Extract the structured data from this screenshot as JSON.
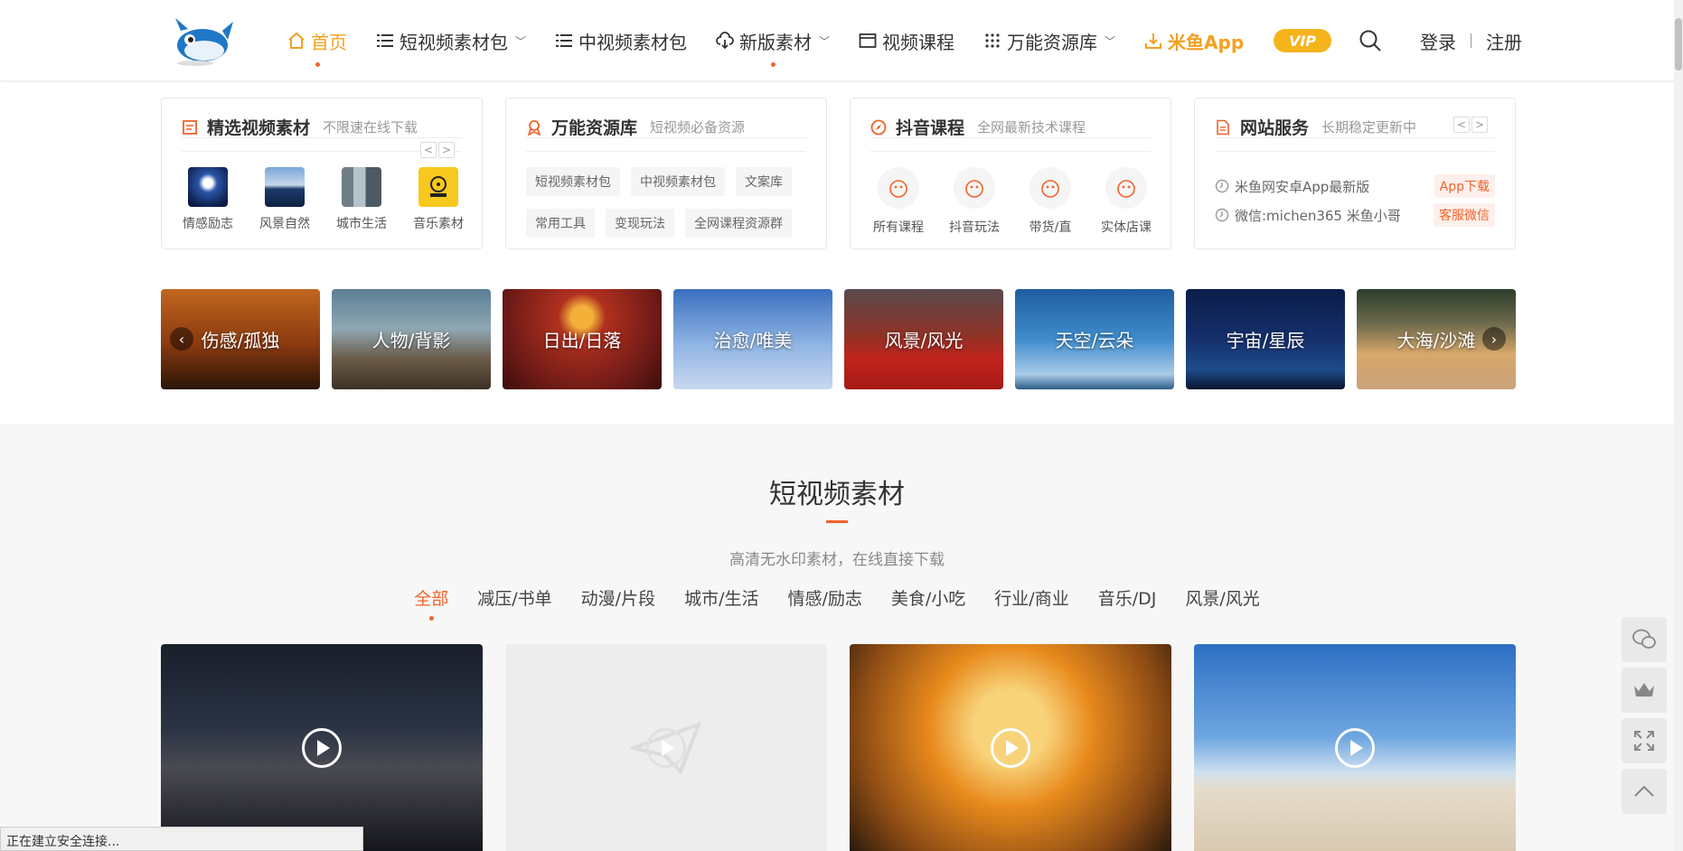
{
  "header": {
    "logo_icon": "pufferfish-logo",
    "nav": [
      {
        "label": "首页",
        "icon": "home-icon",
        "active": true
      },
      {
        "label": "短视频素材包",
        "icon": "list-icon",
        "dropdown": true
      },
      {
        "label": "中视频素材包",
        "icon": "list-icon"
      },
      {
        "label": "新版素材",
        "icon": "cloud-download-icon",
        "dropdown": true,
        "dot": true
      },
      {
        "label": "视频课程",
        "icon": "video-window-icon"
      },
      {
        "label": "万能资源库",
        "icon": "grid-icon",
        "dropdown": true
      },
      {
        "label": "米鱼App",
        "icon": "download-icon"
      }
    ],
    "vip_label": "VIP",
    "login": "登录",
    "register": "注册"
  },
  "cards": {
    "featured": {
      "title": "精选视频素材",
      "subtitle": "不限速在线下载",
      "items": [
        {
          "label": "情感励志"
        },
        {
          "label": "风景自然"
        },
        {
          "label": "城市生活"
        },
        {
          "label": "音乐素材"
        }
      ]
    },
    "library": {
      "title": "万能资源库",
      "subtitle": "短视频必备资源",
      "tags": [
        "短视频素材包",
        "中视频素材包",
        "文案库",
        "常用工具",
        "变现玩法",
        "全网课程资源群"
      ]
    },
    "douyin": {
      "title": "抖音课程",
      "subtitle": "全网最新技术课程",
      "items": [
        {
          "label": "所有课程"
        },
        {
          "label": "抖音玩法"
        },
        {
          "label": "带货/直"
        },
        {
          "label": "实体店课"
        }
      ]
    },
    "service": {
      "title": "网站服务",
      "subtitle": "长期稳定更新中",
      "rows": [
        {
          "text": "米鱼网安卓App最新版",
          "button": "App下载"
        },
        {
          "text": "微信:michen365 米鱼小哥",
          "button": "客服微信"
        }
      ]
    }
  },
  "banners": [
    {
      "label": "伤感/孤独"
    },
    {
      "label": "人物/背影"
    },
    {
      "label": "日出/日落"
    },
    {
      "label": "治愈/唯美"
    },
    {
      "label": "风景/风光"
    },
    {
      "label": "天空/云朵"
    },
    {
      "label": "宇宙/星辰"
    },
    {
      "label": "大海/沙滩"
    }
  ],
  "section": {
    "title": "短视频素材",
    "subtitle": "高清无水印素材，在线直接下载",
    "filters": [
      "全部",
      "减压/书单",
      "动漫/片段",
      "城市/生活",
      "情感/励志",
      "美食/小吃",
      "行业/商业",
      "音乐/DJ",
      "风景/风光"
    ],
    "active_filter": "全部"
  },
  "videos": [
    {
      "scene": "city-night"
    },
    {
      "scene": "placeholder"
    },
    {
      "scene": "dandelion-sunset"
    },
    {
      "scene": "wind-turbines-beach"
    }
  ],
  "tools": [
    "wechat-icon",
    "crown-icon",
    "fullscreen-icon",
    "back-to-top-icon"
  ],
  "status_bar": "正在建立安全连接...",
  "colors": {
    "accent": "#f2622a",
    "nav_active": "#f4a020",
    "vip": "#f5b31c"
  }
}
